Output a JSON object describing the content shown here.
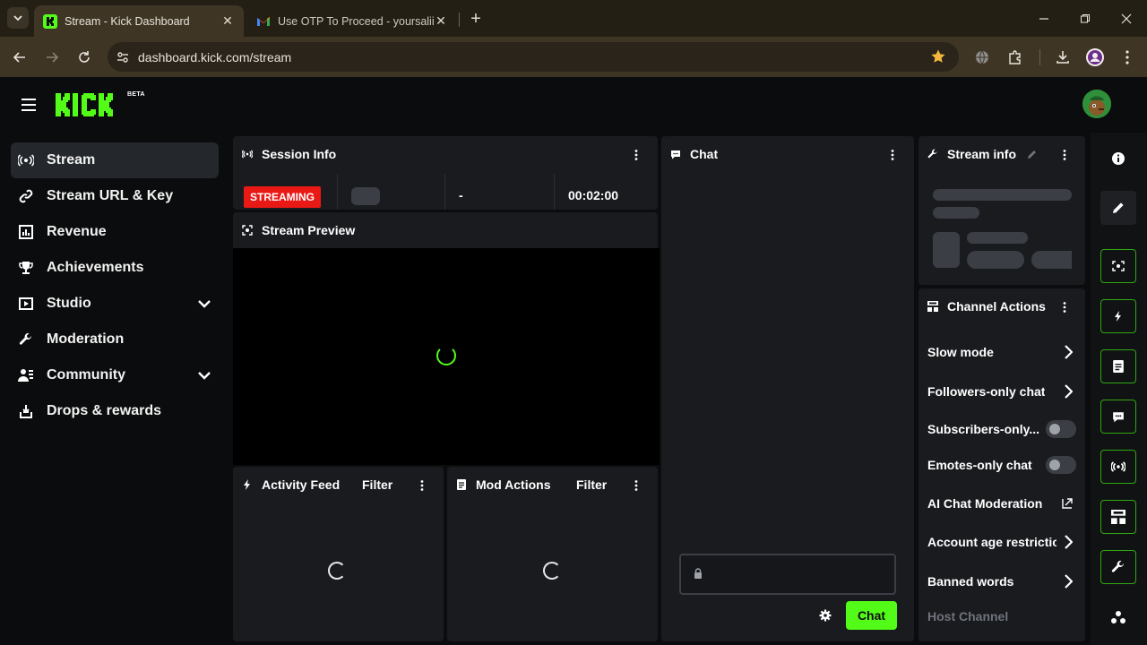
{
  "browser": {
    "tabs": [
      {
        "title": "Stream - Kick Dashboard",
        "active": true,
        "icon": "kick-favicon"
      },
      {
        "title": "Use OTP To Proceed - yoursaliin",
        "active": false,
        "icon": "gmail-favicon"
      }
    ],
    "url": "dashboard.kick.com/stream"
  },
  "header": {
    "logo_text": "KICK",
    "beta_label": "BETA"
  },
  "sidebar": {
    "items": [
      {
        "label": "Stream",
        "icon": "broadcast-icon",
        "active": true
      },
      {
        "label": "Stream URL & Key",
        "icon": "link-icon"
      },
      {
        "label": "Revenue",
        "icon": "bar-chart-icon"
      },
      {
        "label": "Achievements",
        "icon": "trophy-icon"
      },
      {
        "label": "Studio",
        "icon": "studio-icon",
        "expandable": true
      },
      {
        "label": "Moderation",
        "icon": "wrench-icon"
      },
      {
        "label": "Community",
        "icon": "users-icon",
        "expandable": true
      },
      {
        "label": "Drops & rewards",
        "icon": "drops-icon"
      }
    ]
  },
  "session": {
    "title": "Session Info",
    "status": "STREAMING",
    "viewers": "-",
    "uptime": "00:02:00"
  },
  "preview": {
    "title": "Stream Preview"
  },
  "activity": {
    "title": "Activity Feed",
    "filter": "Filter"
  },
  "mod_actions": {
    "title": "Mod Actions",
    "filter": "Filter"
  },
  "chat": {
    "title": "Chat",
    "send_label": "Chat",
    "input_value": ""
  },
  "stream_info": {
    "title": "Stream info"
  },
  "channel_actions": {
    "title": "Channel Actions",
    "items": [
      {
        "label": "Slow mode",
        "control": "arrow"
      },
      {
        "label": "Followers-only chat",
        "control": "arrow"
      },
      {
        "label": "Subscribers-only...",
        "control": "toggle",
        "on": false
      },
      {
        "label": "Emotes-only chat",
        "control": "toggle",
        "on": false
      },
      {
        "label": "AI Chat Moderation",
        "control": "external"
      },
      {
        "label": "Account age restrictio",
        "control": "arrow"
      },
      {
        "label": "Banned words",
        "control": "arrow"
      },
      {
        "label": "Host Channel",
        "control": "none",
        "disabled": true
      }
    ]
  },
  "colors": {
    "brand": "#53fc18",
    "live": "#e91916",
    "panel": "#191b1f",
    "page": "#0b0c0d"
  },
  "rail_icons": [
    "info-icon",
    "edit-icon",
    "preview-icon",
    "activity-icon",
    "mod-actions-icon",
    "chat-icon",
    "session-icon",
    "channel-actions-icon",
    "moderation-icon",
    "more-icon"
  ]
}
